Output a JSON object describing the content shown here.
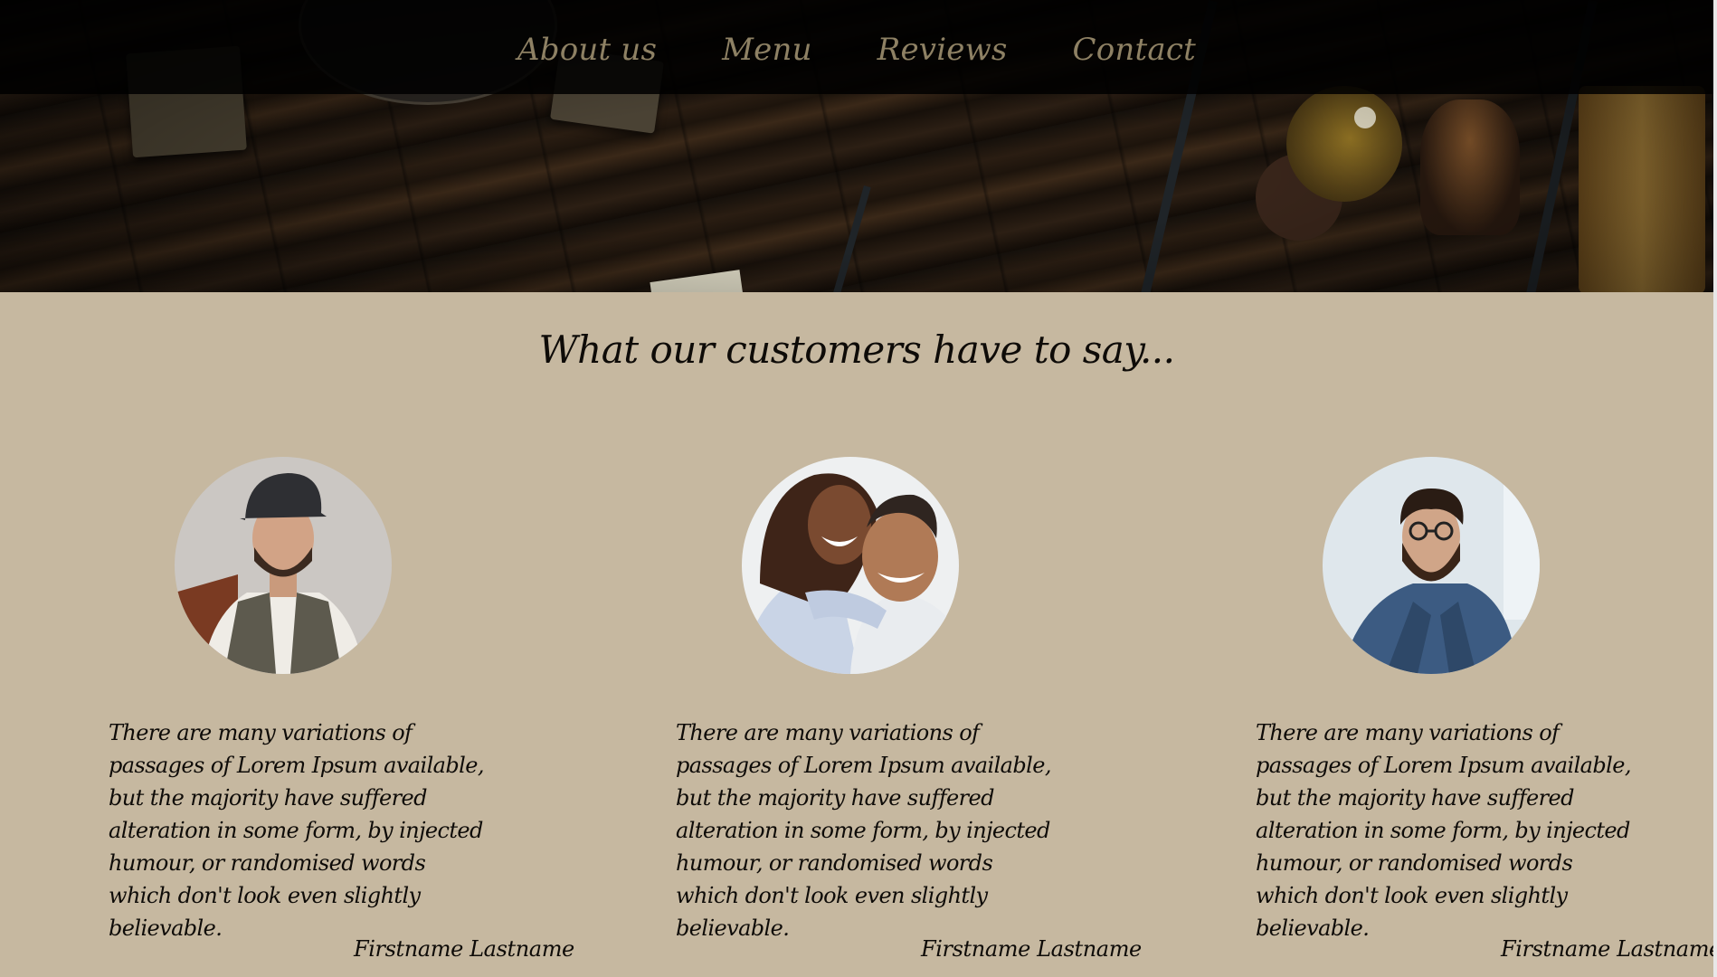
{
  "nav": {
    "items": [
      {
        "label": "About us"
      },
      {
        "label": "Menu"
      },
      {
        "label": "Reviews"
      },
      {
        "label": "Contact"
      }
    ]
  },
  "testimonials": {
    "title": "What our customers have to say...",
    "items": [
      {
        "quote": "There are many variations of passages of Lorem Ipsum available, but the majority have suffered alteration in some form, by injected humour, or randomised words which don't look even slightly believable.",
        "author": "Firstname Lastname",
        "photo": "man-in-flat-cap-and-vest"
      },
      {
        "quote": "There are many variations of passages of Lorem Ipsum available, but the majority have suffered alteration in some form, by injected humour, or randomised words which don't look even slightly believable.",
        "author": "Firstname Lastname",
        "photo": "smiling-couple-embracing"
      },
      {
        "quote": "There are many variations of passages of Lorem Ipsum available, but the majority have suffered alteration in some form, by injected humour, or randomised words which don't look even slightly believable.",
        "author": "Firstname Lastname",
        "photo": "bearded-man-in-denim-shirt"
      }
    ]
  },
  "colors": {
    "page_background": "#c6b8a0",
    "nav_background": "#000000",
    "nav_text": "#8e8164",
    "body_text": "#0e0b08"
  }
}
